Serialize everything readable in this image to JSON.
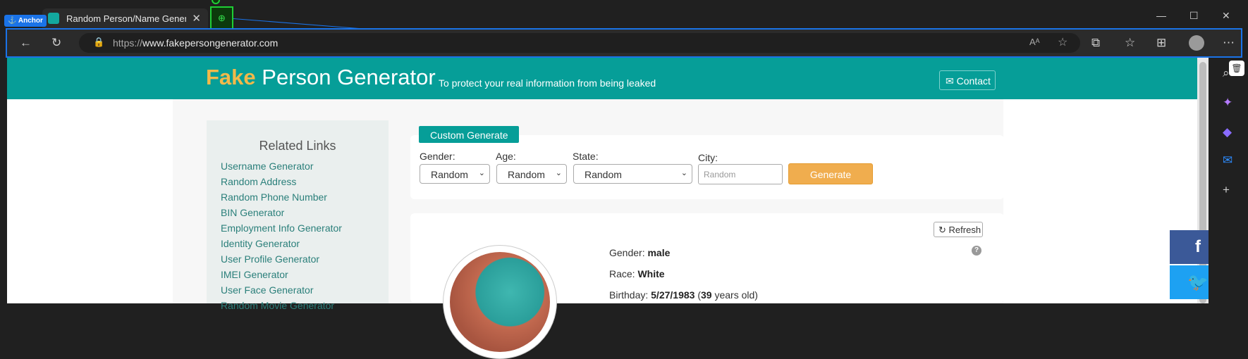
{
  "browser": {
    "tab_title": "Random Person/Name Generator",
    "url_prefix": "https://",
    "url_domain": "www.fakepersongenerator.com",
    "anchor_label": "Anchor"
  },
  "header": {
    "brand_fake": "Fake",
    "brand_rest": " Person Generator",
    "tagline": "To protect your real information from being leaked",
    "contact_label": "Contact"
  },
  "related": {
    "title": "Related Links",
    "links": [
      "Username Generator",
      "Random Address",
      "Random Phone Number",
      "BIN Generator",
      "Employment Info Generator",
      "Identity Generator",
      "User Profile Generator",
      "IMEI Generator",
      "User Face Generator",
      "Random Movie Generator"
    ]
  },
  "custom": {
    "tab_label": "Custom Generate",
    "gender_label": "Gender:",
    "gender_value": "Random",
    "age_label": "Age:",
    "age_value": "Random",
    "state_label": "State:",
    "state_value": "Random",
    "city_label": "City:",
    "city_placeholder": "Random",
    "generate_label": "Generate"
  },
  "person": {
    "refresh_label": "Refresh",
    "gender_key": "Gender: ",
    "gender": "male",
    "race_key": "Race: ",
    "race": "White",
    "birthday_key": "Birthday: ",
    "birthday": "5/27/1983",
    "age": "39",
    "age_suffix": " years old)"
  },
  "colors": {
    "brand_teal": "#069e98",
    "brand_orange": "#f2b94a",
    "generate_button": "#f0ad4e"
  }
}
